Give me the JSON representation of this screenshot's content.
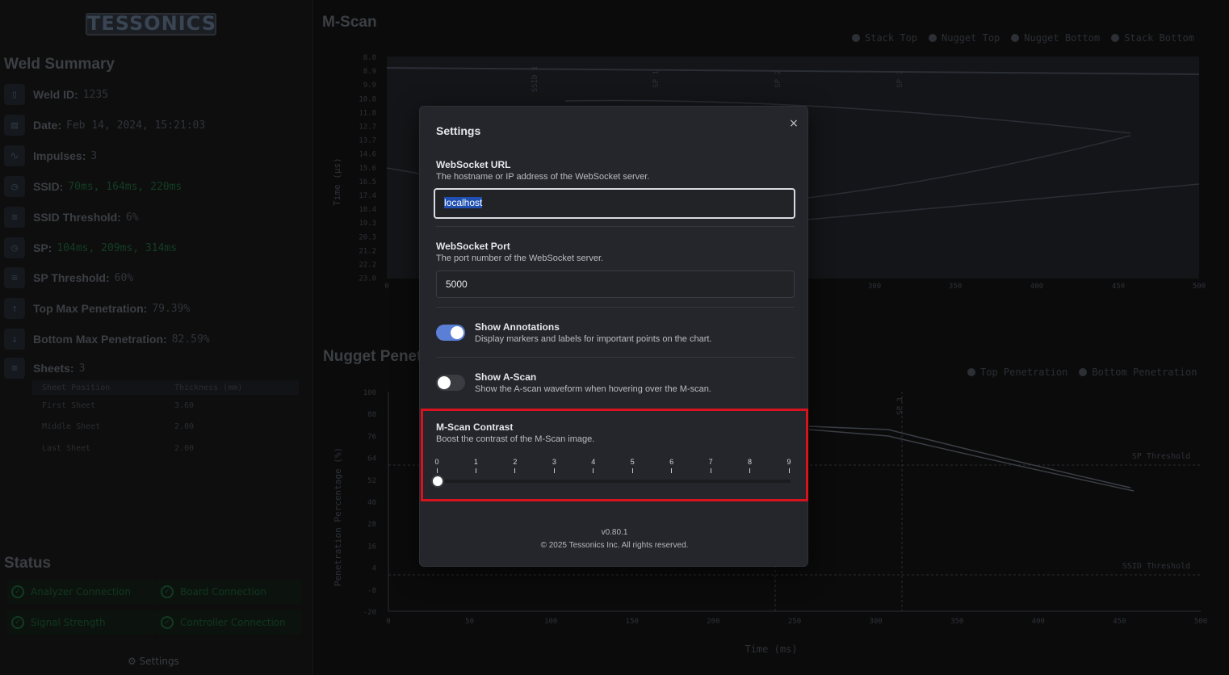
{
  "sidebar": {
    "logo": "TESSONICS",
    "weld_summary_title": "Weld Summary",
    "summary": [
      {
        "icon": "id-card-icon",
        "label": "Weld ID:",
        "value": "1235"
      },
      {
        "icon": "calendar-icon",
        "label": "Date:",
        "value": "Feb 14, 2024, 15:21:03"
      },
      {
        "icon": "pulse-icon",
        "label": "Impulses:",
        "value": "3"
      },
      {
        "icon": "clock-icon",
        "label": "SSID:",
        "value": "70ms, 164ms, 220ms"
      },
      {
        "icon": "layers-icon",
        "label": "SSID Threshold:",
        "value": "6%"
      },
      {
        "icon": "clock-icon",
        "label": "SP:",
        "value": "104ms, 209ms, 314ms"
      },
      {
        "icon": "layers-icon",
        "label": "SP Threshold:",
        "value": "60%"
      },
      {
        "icon": "arrow-up-icon",
        "label": "Top Max Penetration:",
        "value": "79.39%"
      },
      {
        "icon": "arrow-down-icon",
        "label": "Bottom Max Penetration:",
        "value": "82.59%"
      },
      {
        "icon": "stack-icon",
        "label": "Sheets:",
        "value": "3"
      }
    ],
    "sheets_table": {
      "headers": [
        "Sheet Position",
        "Thickness (mm)"
      ],
      "rows": [
        [
          "First Sheet",
          "3.60"
        ],
        [
          "Middle Sheet",
          "2.00"
        ],
        [
          "Last Sheet",
          "2.00"
        ]
      ]
    },
    "status_title": "Status",
    "status_items": [
      "Analyzer Connection",
      "Board Connection",
      "Signal Strength",
      "Controller Connection"
    ],
    "settings_label": "Settings"
  },
  "mscan": {
    "title": "M-Scan",
    "legend": [
      "Stack Top",
      "Nugget Top",
      "Nugget Bottom",
      "Stack Bottom"
    ],
    "ylabel": "Time (µs)",
    "y_ticks": [
      "8.0",
      "8.9",
      "9.9",
      "10.8",
      "11.8",
      "12.7",
      "13.7",
      "14.6",
      "15.6",
      "16.5",
      "17.4",
      "18.4",
      "19.3",
      "20.3",
      "21.2",
      "22.2",
      "23.0"
    ],
    "x_ticks": [
      "0",
      "300",
      "350",
      "400",
      "450",
      "500"
    ],
    "markers": [
      "SSID 1",
      "SP 1",
      "SP 2",
      "SP 3"
    ]
  },
  "nugget": {
    "title": "Nugget Penetration",
    "legend": [
      "Top Penetration",
      "Bottom Penetration"
    ],
    "ylabel": "Penetration Percentage (%)",
    "xlabel": "Time (ms)",
    "y_ticks": [
      "100",
      "88",
      "76",
      "64",
      "52",
      "40",
      "28",
      "16",
      "4",
      "-8",
      "-20"
    ],
    "x_ticks": [
      "0",
      "50",
      "100",
      "150",
      "200",
      "250",
      "300",
      "350",
      "400",
      "450",
      "500"
    ],
    "threshold_labels": [
      "SP Threshold",
      "SSID Threshold"
    ],
    "marker": "SP 3"
  },
  "modal": {
    "title": "Settings",
    "close": "×",
    "ws_url": {
      "label": "WebSocket URL",
      "desc": "The hostname or IP address of the WebSocket server.",
      "value": "localhost"
    },
    "ws_port": {
      "label": "WebSocket Port",
      "desc": "The port number of the WebSocket server.",
      "value": "5000"
    },
    "annotations": {
      "label": "Show Annotations",
      "desc": "Display markers and labels for important points on the chart.",
      "enabled": true
    },
    "ascan": {
      "label": "Show A-Scan",
      "desc": "Show the A-scan waveform when hovering over the M-scan.",
      "enabled": false
    },
    "contrast": {
      "label": "M-Scan Contrast",
      "desc": "Boost the contrast of the M-Scan image.",
      "ticks": [
        "0",
        "1",
        "2",
        "3",
        "4",
        "5",
        "6",
        "7",
        "8",
        "9"
      ],
      "value": 0
    },
    "version": "v0.80.1",
    "copyright": "© 2025 Tessonics Inc. All rights reserved."
  },
  "colors": {
    "accent": "#5b7fd6",
    "highlight": "#d9121f",
    "status_ok": "#123a22"
  }
}
